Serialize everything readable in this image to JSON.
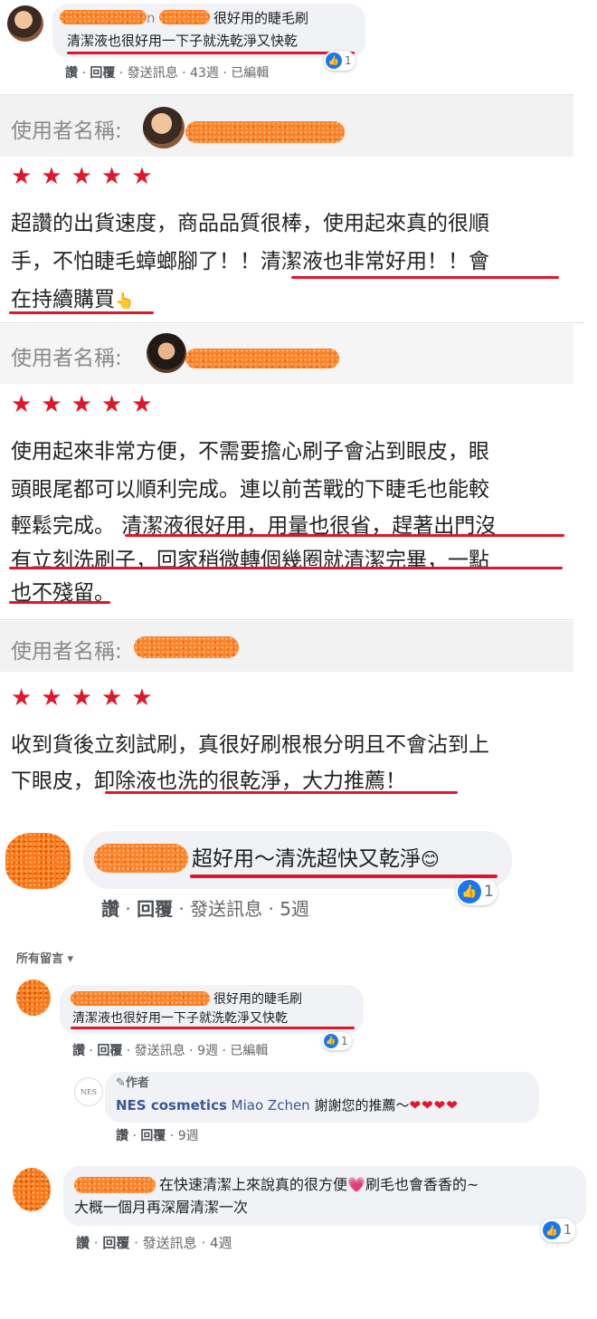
{
  "c1": {
    "name_tail": "n",
    "text1": "很好用的睫毛刷",
    "text2": "清潔液也很好用一下子就洗乾淨又快乾",
    "actions": [
      "讚",
      "回覆",
      "發送訊息",
      "43週",
      "已編輯"
    ],
    "likes": "1"
  },
  "r1": {
    "label": "使用者名稱:",
    "stars": "★★★★★",
    "line1": "超讚的出貨速度，商品品質很棒，使用起來真的很順",
    "line2": "手，不怕睫毛蟑螂腳了！！清潔液也非常好用！！會",
    "line3": "在持續購買",
    "emoji": "👆"
  },
  "r2": {
    "label": "使用者名稱:",
    "stars": "★★★★★",
    "line1": "使用起來非常方便，不需要擔心刷子會沾到眼皮，眼",
    "line2": "頭眼尾都可以順利完成。連以前苦戰的下睫毛也能較",
    "line3": "輕鬆完成。 清潔液很好用，用量也很省，趕著出門沒",
    "line4": "有立刻洗刷子，回家稍微轉個幾圈就清潔完畢，一點",
    "line5": "也不殘留。"
  },
  "r3": {
    "label": "使用者名稱:",
    "stars": "★★★★★",
    "line1": "收到貨後立刻試刷，真很好刷根根分明且不會沾到上",
    "line2": "下眼皮，卸除液也洗的很乾淨，大力推薦！"
  },
  "c2": {
    "text": "超好用～清洗超快又乾淨",
    "emoji": "😊",
    "actions": [
      "讚",
      "回覆",
      "發送訊息",
      "5週"
    ],
    "likes": "1"
  },
  "section": {
    "label": "所有留言",
    "caret": "▾"
  },
  "c3": {
    "text1": "很好用的睫毛刷",
    "text2": "清潔液也很好用一下子就洗乾淨又快乾",
    "actions": [
      "讚",
      "回覆",
      "發送訊息",
      "9週",
      "已編輯"
    ],
    "likes": "1"
  },
  "reply": {
    "logo": "NES",
    "author_tag": "作者",
    "author_name": "NES cosmetics",
    "mention": "Miao Zchen",
    "text": "謝謝您的推薦～",
    "hearts": "❤❤❤❤",
    "actions": [
      "讚",
      "回覆",
      "9週"
    ]
  },
  "c4": {
    "text1": "在快速清潔上來說真的很方便",
    "heart": "💗",
    "text1b": "刷毛也會香香的~",
    "text2": "大概一個月再深層清潔一次",
    "actions": [
      "讚",
      "回覆",
      "發送訊息",
      "4週"
    ],
    "likes": "1"
  },
  "colors": {
    "accent_red": "#e0162b",
    "fb_blue": "#1877f2",
    "bubble": "#f0f2f5",
    "blot": "#ff7a1a"
  }
}
